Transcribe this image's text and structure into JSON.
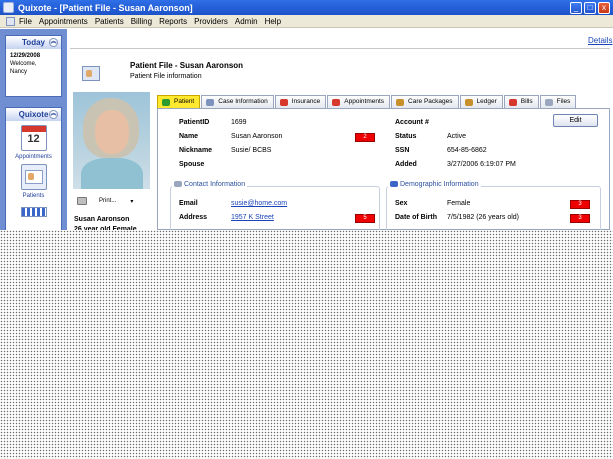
{
  "window": {
    "title": "Quixote - [Patient File - Susan Aaronson]",
    "buttons": [
      "_",
      "□",
      "x"
    ]
  },
  "menubar": {
    "items": [
      "File",
      "Appointments",
      "Patients",
      "Billing",
      "Reports",
      "Providers",
      "Admin",
      "Help"
    ]
  },
  "sidebar": {
    "today": {
      "header": "Today",
      "date": "12/29/2008",
      "welcome": "Welcome,",
      "user": "Nancy"
    },
    "quixote": {
      "header": "Quixote",
      "calendar_day": "12",
      "items": [
        {
          "label": "Appointments",
          "icon": "calendar-icon"
        },
        {
          "label": "Patients",
          "icon": "patient-card-icon"
        }
      ]
    }
  },
  "header": {
    "details_link": "Details",
    "title": "Patient File - Susan Aaronson",
    "subtitle": "Patient File information"
  },
  "profile": {
    "print_label": "Print...",
    "print_caret": "▾",
    "name": "Susan Aaronson",
    "age_gender": "26 year old Female"
  },
  "tabs": [
    {
      "label": "Patient",
      "active": true,
      "icon_color": "#2c9a2c"
    },
    {
      "label": "Case Information",
      "active": false,
      "icon_color": "#7d92bc"
    },
    {
      "label": "Insurance",
      "active": false,
      "icon_color": "#d6382d"
    },
    {
      "label": "Appointments",
      "active": false,
      "icon_color": "#d6382d"
    },
    {
      "label": "Care Packages",
      "active": false,
      "icon_color": "#c7902a"
    },
    {
      "label": "Ledger",
      "active": false,
      "icon_color": "#c7902a"
    },
    {
      "label": "Bills",
      "active": false,
      "icon_color": "#d6382d"
    },
    {
      "label": "Files",
      "active": false,
      "icon_color": "#9aa6bd"
    }
  ],
  "patient": {
    "edit_label": "Edit",
    "left": [
      {
        "label": "PatientID",
        "value": "1699"
      },
      {
        "label": "Name",
        "value": "Susan Aaronson",
        "badge": "2"
      },
      {
        "label": "Nickname",
        "value": "Susie/ BCBS"
      },
      {
        "label": "Spouse",
        "value": ""
      }
    ],
    "right": [
      {
        "label": "Account #",
        "value": ""
      },
      {
        "label": "Status",
        "value": "Active"
      },
      {
        "label": "SSN",
        "value": "654-85-6862"
      },
      {
        "label": "Added",
        "value": "3/27/2006 6:19:07 PM"
      }
    ],
    "contact": {
      "title": "Contact Information",
      "email_label": "Email",
      "email_value": "susie@home.com",
      "address_label": "Address",
      "address_value": "1957 K Street",
      "address_badge": "5"
    },
    "demographic": {
      "title": "Demographic Information",
      "sex_label": "Sex",
      "sex_value": "Female",
      "sex_badge": "3",
      "dob_label": "Date of Birth",
      "dob_value": "7/5/1982 (26 years old)",
      "dob_badge": "3"
    }
  },
  "colors": {
    "title_bar": "#2f6fe8",
    "sidebar": "#6f8fd2",
    "active_tab": "#ffe92e",
    "badge": "#ee0000",
    "link": "#1a45b8"
  }
}
